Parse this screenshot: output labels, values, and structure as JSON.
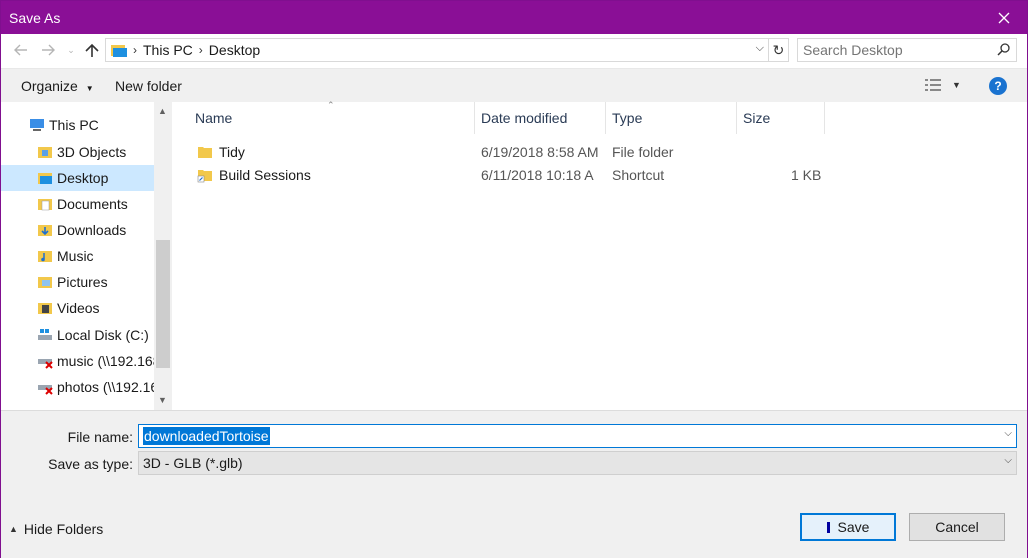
{
  "window": {
    "title": "Save As"
  },
  "address": {
    "crumbs": [
      "This PC",
      "Desktop"
    ]
  },
  "search": {
    "placeholder": "Search Desktop"
  },
  "toolbar": {
    "organize": "Organize",
    "new_folder": "New folder",
    "help": "?"
  },
  "sidebar": {
    "items": [
      {
        "label": "This PC",
        "icon": "computer-icon"
      },
      {
        "label": "3D Objects",
        "icon": "folder-3d-icon"
      },
      {
        "label": "Desktop",
        "icon": "desktop-folder-icon",
        "selected": true
      },
      {
        "label": "Documents",
        "icon": "documents-folder-icon"
      },
      {
        "label": "Downloads",
        "icon": "downloads-folder-icon"
      },
      {
        "label": "Music",
        "icon": "music-folder-icon"
      },
      {
        "label": "Pictures",
        "icon": "pictures-folder-icon"
      },
      {
        "label": "Videos",
        "icon": "videos-folder-icon"
      },
      {
        "label": "Local Disk (C:)",
        "icon": "drive-icon"
      },
      {
        "label": "music (\\\\192.168",
        "icon": "network-drive-disconnected-icon"
      },
      {
        "label": "photos (\\\\192.16",
        "icon": "network-drive-disconnected-icon"
      }
    ]
  },
  "files": {
    "columns": [
      "Name",
      "Date modified",
      "Type",
      "Size"
    ],
    "rows": [
      {
        "name": "Tidy",
        "date": "6/19/2018 8:58 AM",
        "type": "File folder",
        "size": "",
        "icon": "folder-icon"
      },
      {
        "name": "Build Sessions",
        "date": "6/11/2018 10:18 A",
        "type": "Shortcut",
        "size": "1 KB",
        "icon": "shortcut-folder-icon"
      }
    ]
  },
  "form": {
    "file_name_label": "File name:",
    "file_name_value": "downloadedTortoise",
    "save_type_label": "Save as type:",
    "save_type_value": "3D - GLB (*.glb)"
  },
  "footer": {
    "hide_folders": "Hide Folders",
    "save": "Save",
    "cancel": "Cancel"
  },
  "colors": {
    "titlebar": "#8a0f96",
    "accent": "#0078d7",
    "selection": "#cce8ff"
  }
}
